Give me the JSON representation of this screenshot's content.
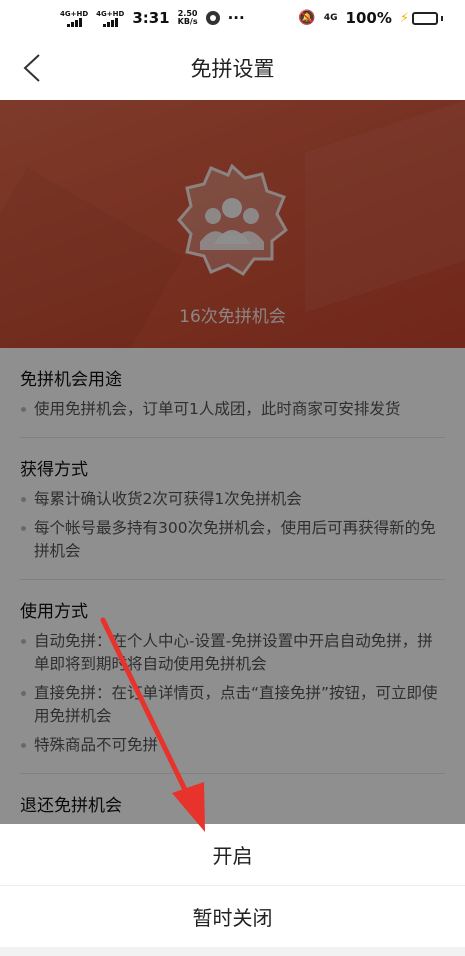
{
  "status_bar": {
    "network1": "4G+HD",
    "network2": "4G+HD",
    "time": "3:31",
    "speed_value": "2.50",
    "speed_unit": "KB/s",
    "more": "···",
    "net_type": "4G",
    "battery": "100%"
  },
  "header": {
    "title": "免拼设置"
  },
  "banner": {
    "text": "16次免拼机会"
  },
  "sections": [
    {
      "title": "免拼机会用途",
      "items": [
        "使用免拼机会，订单可1人成团，此时商家可安排发货"
      ]
    },
    {
      "title": "获得方式",
      "items": [
        "每累计确认收货2次可获得1次免拼机会",
        "每个帐号最多持有300次免拼机会，使用后可再获得新的免拼机会"
      ]
    },
    {
      "title": "使用方式",
      "items": [
        "自动免拼：在个人中心-设置-免拼设置中开启自动免拼，拼单即将到期时将自动使用免拼机会",
        "直接免拼：在订单详情页，点击“直接免拼”按钮，可立即使用免拼机会",
        "特殊商品不可免拼"
      ]
    },
    {
      "title": "退还免拼机会",
      "items": []
    }
  ],
  "action_sheet": {
    "enable_label": "开启",
    "disable_label": "暂时关闭"
  },
  "colors": {
    "banner": "#d4553a",
    "overlay": "rgba(0,0,0,0.44)",
    "arrow": "#e8322c",
    "battery": "#27c24c"
  }
}
